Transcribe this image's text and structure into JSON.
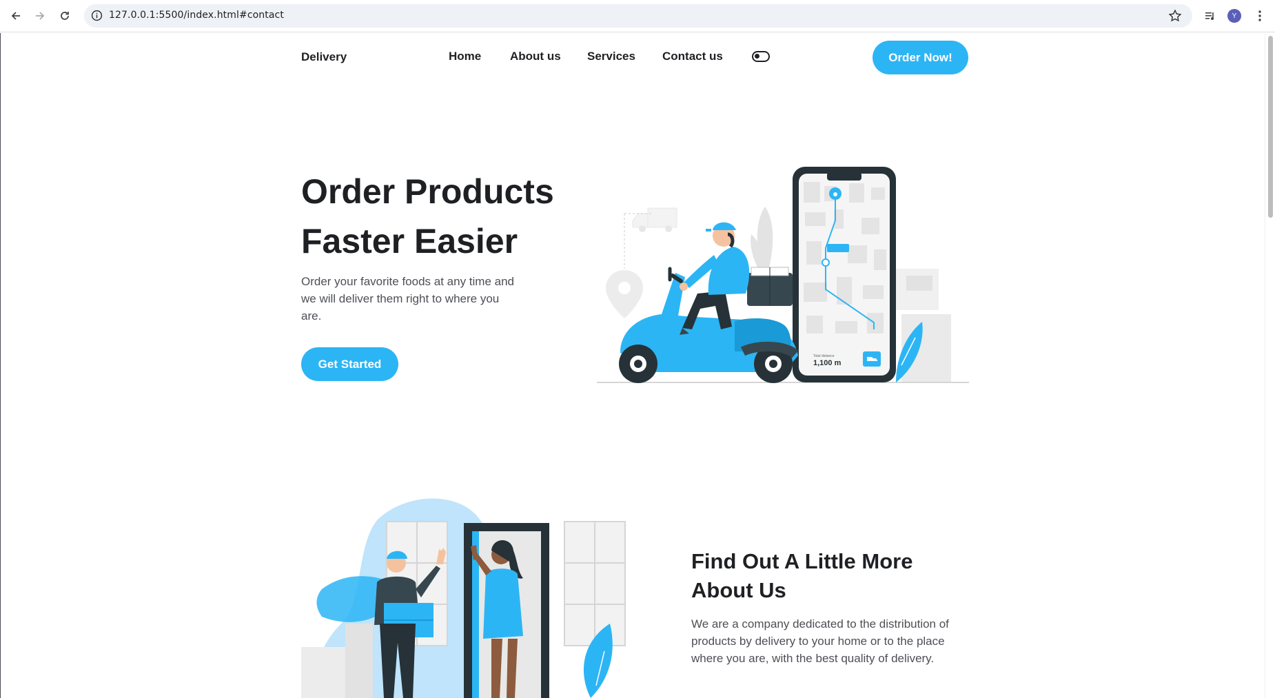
{
  "browser": {
    "url": "127.0.0.1:5500/index.html#contact",
    "profile_initial": "Y"
  },
  "nav": {
    "logo": "Delivery",
    "links": [
      "Home",
      "About us",
      "Services",
      "Contact us"
    ],
    "order_button": "Order Now!"
  },
  "hero": {
    "title_line1": "Order Products",
    "title_line2": "Faster Easier",
    "description": "Order your favorite foods at any time and we will deliver them right to where you are.",
    "cta": "Get Started",
    "phone_distance_label": "Total distance",
    "phone_distance_value": "1,100 m"
  },
  "about": {
    "title_line1": "Find Out A Little More",
    "title_line2": "About Us",
    "description": "We are a company dedicated to the distribution of products by delivery to your home or to the place where you are, with the best quality of delivery."
  },
  "colors": {
    "accent": "#2cb5f5",
    "dark": "#263238"
  }
}
